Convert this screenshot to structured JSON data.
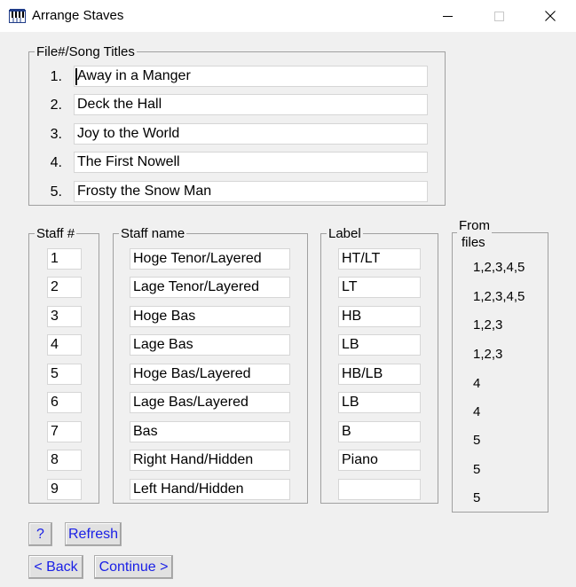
{
  "window": {
    "title": "Arrange Staves",
    "icon": "piano-keys-icon"
  },
  "songs": {
    "legend": "File#/Song Titles",
    "items": [
      {
        "num": "1.",
        "title": "Away in a Manger"
      },
      {
        "num": "2.",
        "title": "Deck the Hall"
      },
      {
        "num": "3.",
        "title": "Joy to the World"
      },
      {
        "num": "4.",
        "title": "The First Nowell"
      },
      {
        "num": "5.",
        "title": "Frosty the Snow Man"
      }
    ]
  },
  "staves": {
    "staff_legend": "Staff #",
    "name_legend": "Staff name",
    "label_legend": "Label",
    "from_legend_line1": "From",
    "from_legend_line2": "files",
    "rows": [
      {
        "num": "1",
        "name": "Hoge Tenor/Layered",
        "label": "HT/LT",
        "from": "1,2,3,4,5"
      },
      {
        "num": "2",
        "name": "Lage Tenor/Layered",
        "label": "LT",
        "from": "1,2,3,4,5"
      },
      {
        "num": "3",
        "name": "Hoge Bas",
        "label": "HB",
        "from": "1,2,3"
      },
      {
        "num": "4",
        "name": "Lage Bas",
        "label": "LB",
        "from": "1,2,3"
      },
      {
        "num": "5",
        "name": "Hoge Bas/Layered",
        "label": "HB/LB",
        "from": "4"
      },
      {
        "num": "6",
        "name": "Lage Bas/Layered",
        "label": "LB",
        "from": "4"
      },
      {
        "num": "7",
        "name": "Bas",
        "label": "B",
        "from": "5"
      },
      {
        "num": "8",
        "name": "Right Hand/Hidden",
        "label": "Piano",
        "from": "5"
      },
      {
        "num": "9",
        "name": "Left Hand/Hidden",
        "label": "",
        "from": "5"
      }
    ]
  },
  "buttons": {
    "help": "?",
    "refresh": "Refresh",
    "back": "< Back",
    "continue": "Continue >"
  },
  "colors": {
    "button_text": "#1a20e6",
    "background": "#f0f0f0",
    "group_border": "#a0a0a0"
  }
}
